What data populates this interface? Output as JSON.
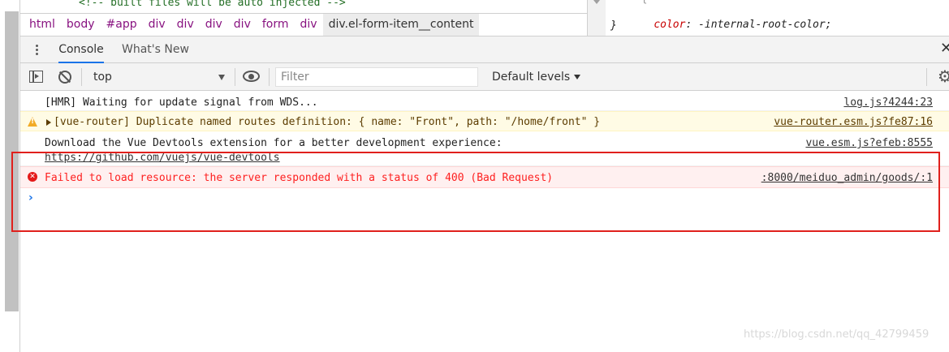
{
  "elements_panel": {
    "comment_line": "<!-- built files will be auto injected -->",
    "breadcrumb": [
      "html",
      "body",
      "#app",
      "div",
      "div",
      "div",
      "div",
      "form",
      "div",
      "div.el-form-item__content"
    ]
  },
  "styles_pane": {
    "property_name": "color",
    "property_value": " -internal-root-color;",
    "close_brace": "}",
    "top_sliver": "  {"
  },
  "drawer": {
    "tabs": [
      {
        "label": "Console",
        "active": true
      },
      {
        "label": "What's New",
        "active": false
      }
    ],
    "close_label": "✕",
    "more_icon": "more-vertical-icon"
  },
  "toolbar": {
    "context": "top",
    "filter_placeholder": "Filter",
    "filter_value": "",
    "levels_label": "Default levels",
    "settings_glyph": "⚙"
  },
  "console": {
    "messages": [
      {
        "level": "info",
        "text": "[HMR] Waiting for update signal from WDS...",
        "source": "log.js?4244:23"
      },
      {
        "level": "warning",
        "text": "[vue-router] Duplicate named routes definition: { name: \"Front\", path: \"/home/front\" }",
        "source": "vue-router.esm.js?fe87:16"
      },
      {
        "level": "info",
        "text": "Download the Vue Devtools extension for a better development experience:",
        "link": "https://github.com/vuejs/vue-devtools",
        "source": "vue.esm.js?efeb:8555"
      },
      {
        "level": "error",
        "text": "Failed to load resource: the server responded with a status of 400 (Bad Request)",
        "source": ":8000/meiduo_admin/goods/:1"
      }
    ],
    "prompt": "›"
  },
  "colors": {
    "accent": "#1a73e8",
    "error_text": "#fe2020",
    "error_bg": "#fff0f0",
    "warning_bg": "#fffbe5",
    "highlight_border": "#e0201c"
  },
  "watermark": "https://blog.csdn.net/qq_42799459"
}
